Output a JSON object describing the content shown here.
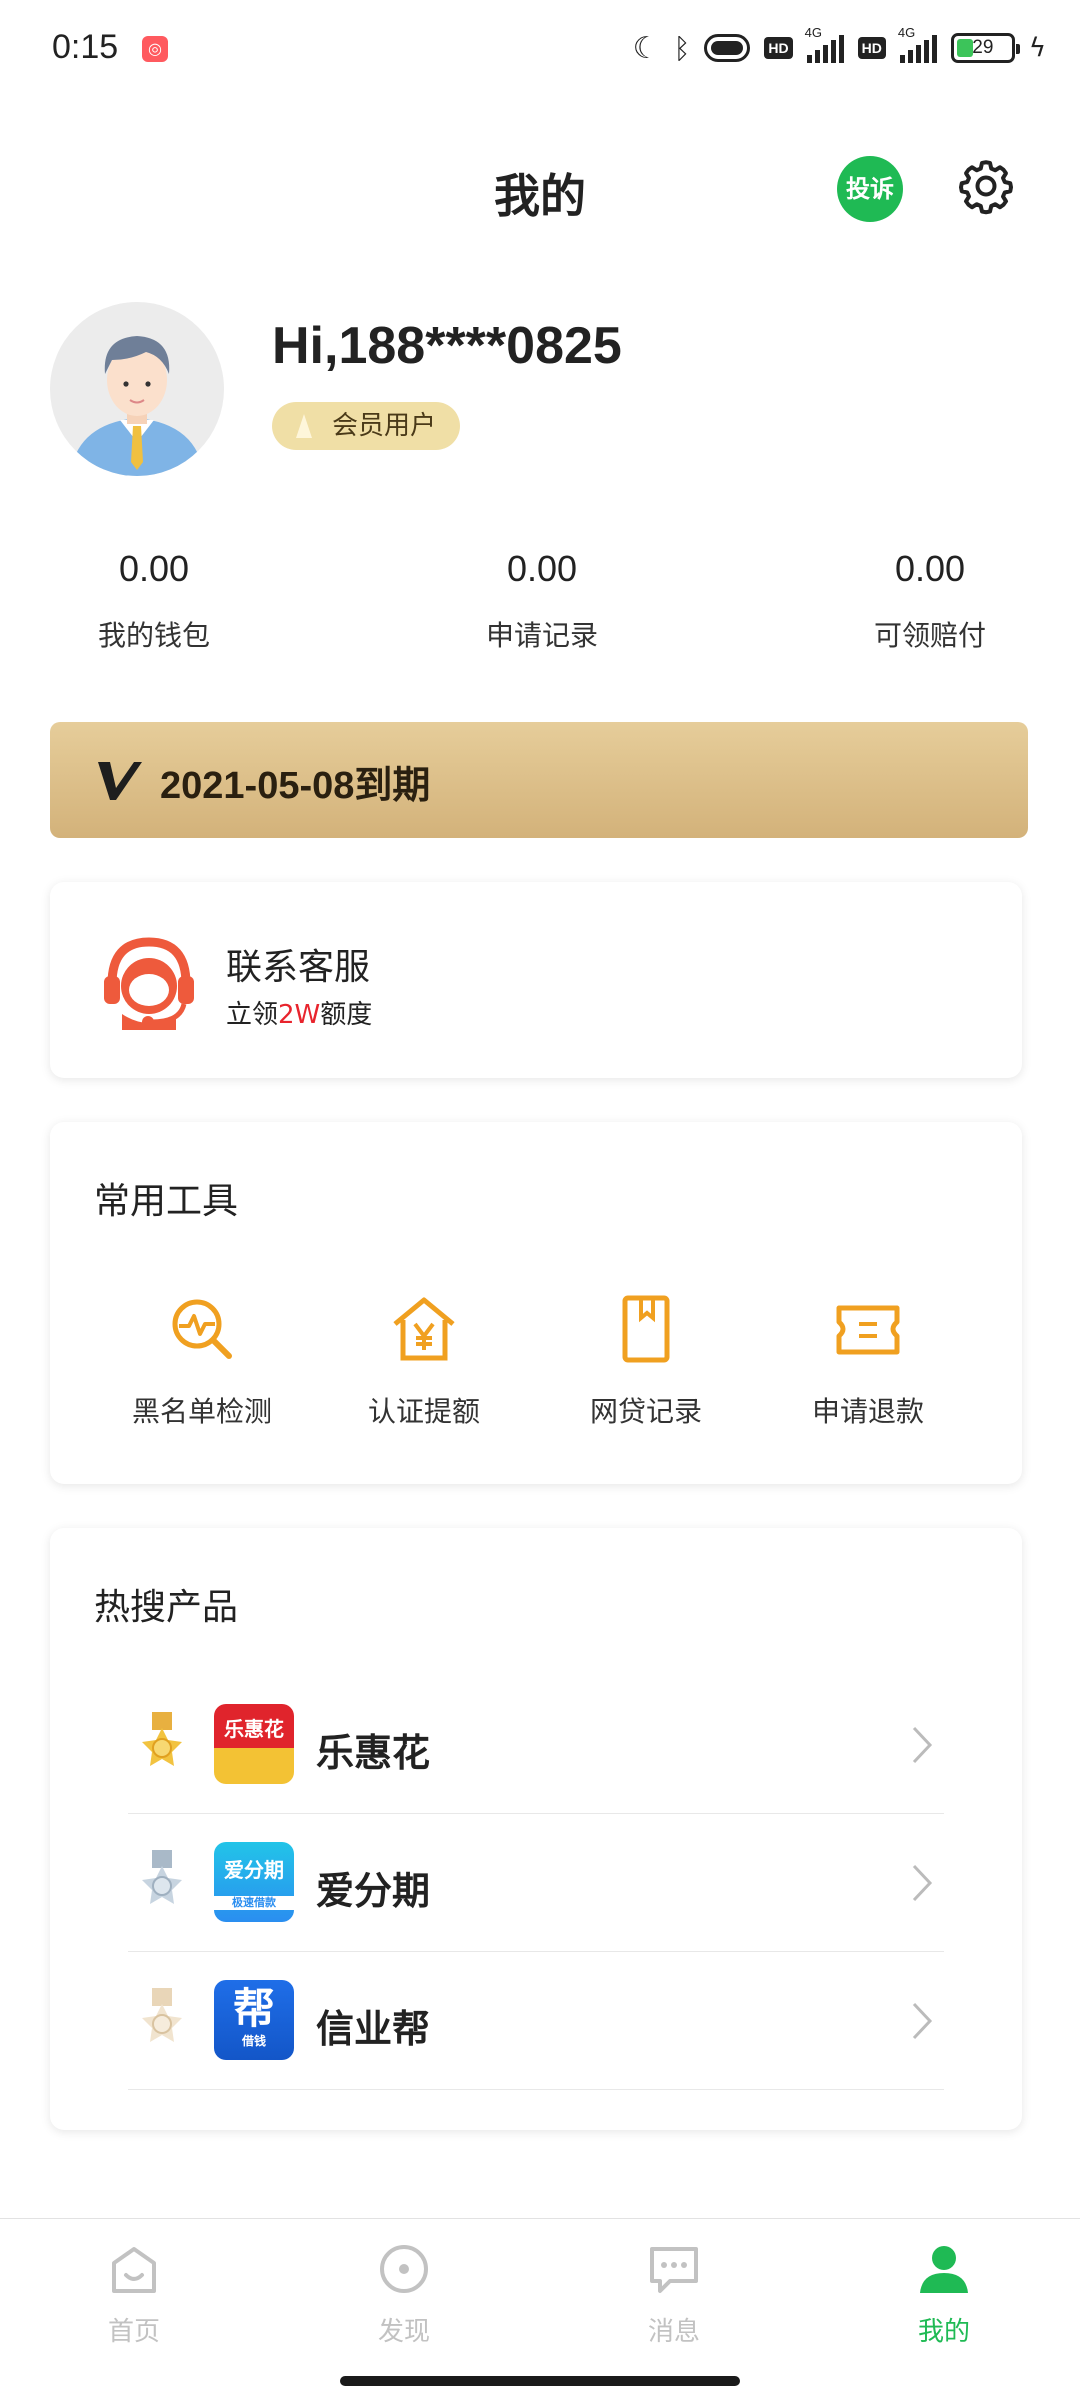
{
  "status_bar": {
    "time": "0:15",
    "battery": "29",
    "network": "4G",
    "hd": "HD",
    "accent": "#3cc45a"
  },
  "header": {
    "title": "我的",
    "complain_label": "投诉",
    "complain_color": "#1fba54"
  },
  "profile": {
    "greeting": "Hi,188****0825",
    "member_label": "会员用户"
  },
  "stats": [
    {
      "value": "0.00",
      "label": "我的钱包"
    },
    {
      "value": "0.00",
      "label": "申请记录"
    },
    {
      "value": "0.00",
      "label": "可领赔付"
    }
  ],
  "vip": {
    "expiry_text": "2021-05-08到期"
  },
  "service": {
    "title": "联系客服",
    "sub_prefix": "立领",
    "sub_highlight": "2W",
    "sub_suffix": "额度",
    "highlight_color": "#e8242d"
  },
  "tools": {
    "heading": "常用工具",
    "items": [
      {
        "label": "黑名单检测",
        "icon": "search-chart-icon"
      },
      {
        "label": "认证提额",
        "icon": "house-yen-icon"
      },
      {
        "label": "网贷记录",
        "icon": "bookmark-book-icon"
      },
      {
        "label": "申请退款",
        "icon": "ticket-icon"
      }
    ],
    "icon_color": "#f0a020"
  },
  "hot_products": {
    "heading": "热搜产品",
    "items": [
      {
        "name": "乐惠花",
        "logo_text": "乐惠花",
        "medal": "gold-medal-icon"
      },
      {
        "name": "爱分期",
        "logo_text": "爱分期",
        "logo_sub": "极速借款",
        "medal": "silver-medal-icon"
      },
      {
        "name": "信业帮",
        "logo_text": "帮",
        "logo_sub": "借钱",
        "medal": "bronze-medal-icon"
      }
    ]
  },
  "bottom_nav": {
    "items": [
      {
        "label": "首页",
        "icon": "home-icon"
      },
      {
        "label": "发现",
        "icon": "discover-icon"
      },
      {
        "label": "消息",
        "icon": "message-icon"
      },
      {
        "label": "我的",
        "icon": "profile-icon",
        "active": true
      }
    ],
    "active_color": "#1fba54",
    "inactive_color": "#c2c2c2"
  }
}
